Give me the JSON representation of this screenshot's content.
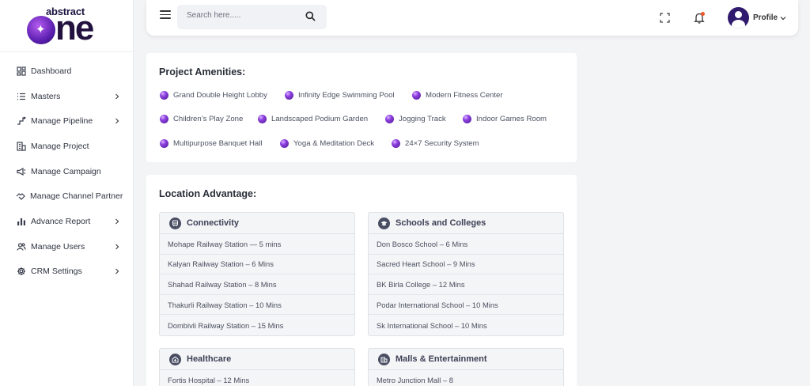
{
  "brand": {
    "top": "abstract",
    "bottom": "one"
  },
  "sidebar": {
    "items": [
      {
        "label": "Dashboard",
        "icon": "dashboard-icon",
        "has_submenu": false
      },
      {
        "label": "Masters",
        "icon": "list-icon",
        "has_submenu": true
      },
      {
        "label": "Manage Pipeline",
        "icon": "pipeline-icon",
        "has_submenu": true
      },
      {
        "label": "Manage Project",
        "icon": "building-icon",
        "has_submenu": false
      },
      {
        "label": "Manage Campaign",
        "icon": "megaphone-icon",
        "has_submenu": false
      },
      {
        "label": "Manage Channel Partner",
        "icon": "partner-icon",
        "has_submenu": false
      },
      {
        "label": "Advance Report",
        "icon": "bar-chart-icon",
        "has_submenu": true
      },
      {
        "label": "Manage Users",
        "icon": "users-icon",
        "has_submenu": true
      },
      {
        "label": "CRM Settings",
        "icon": "gear-icon",
        "has_submenu": true
      }
    ]
  },
  "topbar": {
    "search_placeholder": "Search here.....",
    "profile_label": "Profile"
  },
  "amenities": {
    "title": "Project Amenities:",
    "items": [
      "Grand Double Height Lobby",
      "Infinity Edge Swimming Pool",
      "Modern Fitness Center",
      "Children’s Play Zone",
      "Landscaped Podium Garden",
      "Jogging Track",
      "Indoor Games Room",
      "Multipurpose Banquet Hall",
      "Yoga & Meditation Deck",
      "24×7 Security System"
    ]
  },
  "location": {
    "title": "Location Advantage:",
    "groups": [
      {
        "title": "Connectivity",
        "icon": "train-icon",
        "rows": [
          "Mohape Railway Station — 5 mins",
          "Kalyan Railway Station – 6 Mins",
          "Shahad Railway Station – 8 Mins",
          "Thakurli Railway Station – 10 Mins",
          "Dombivli Railway Station – 15 Mins"
        ]
      },
      {
        "title": "Schools and Colleges",
        "icon": "graduation-cap-icon",
        "rows": [
          "Don Bosco School – 6 Mins",
          "Sacred Heart School – 9 Mins",
          "BK Birla College – 12 Mins",
          "Podar International School – 10 Mins",
          "Sk International School – 10 Mins"
        ]
      },
      {
        "title": "Healthcare",
        "icon": "hospital-icon",
        "rows": [
          "Fortis Hospital – 12 Mins"
        ]
      },
      {
        "title": "Malls & Entertainment",
        "icon": "mall-icon",
        "rows": [
          "Metro Junction Mall – 8"
        ]
      }
    ]
  },
  "colors": {
    "accent": "#6a2fc4",
    "bell_dot": "#f05a28",
    "background": "#f3f4f6"
  }
}
